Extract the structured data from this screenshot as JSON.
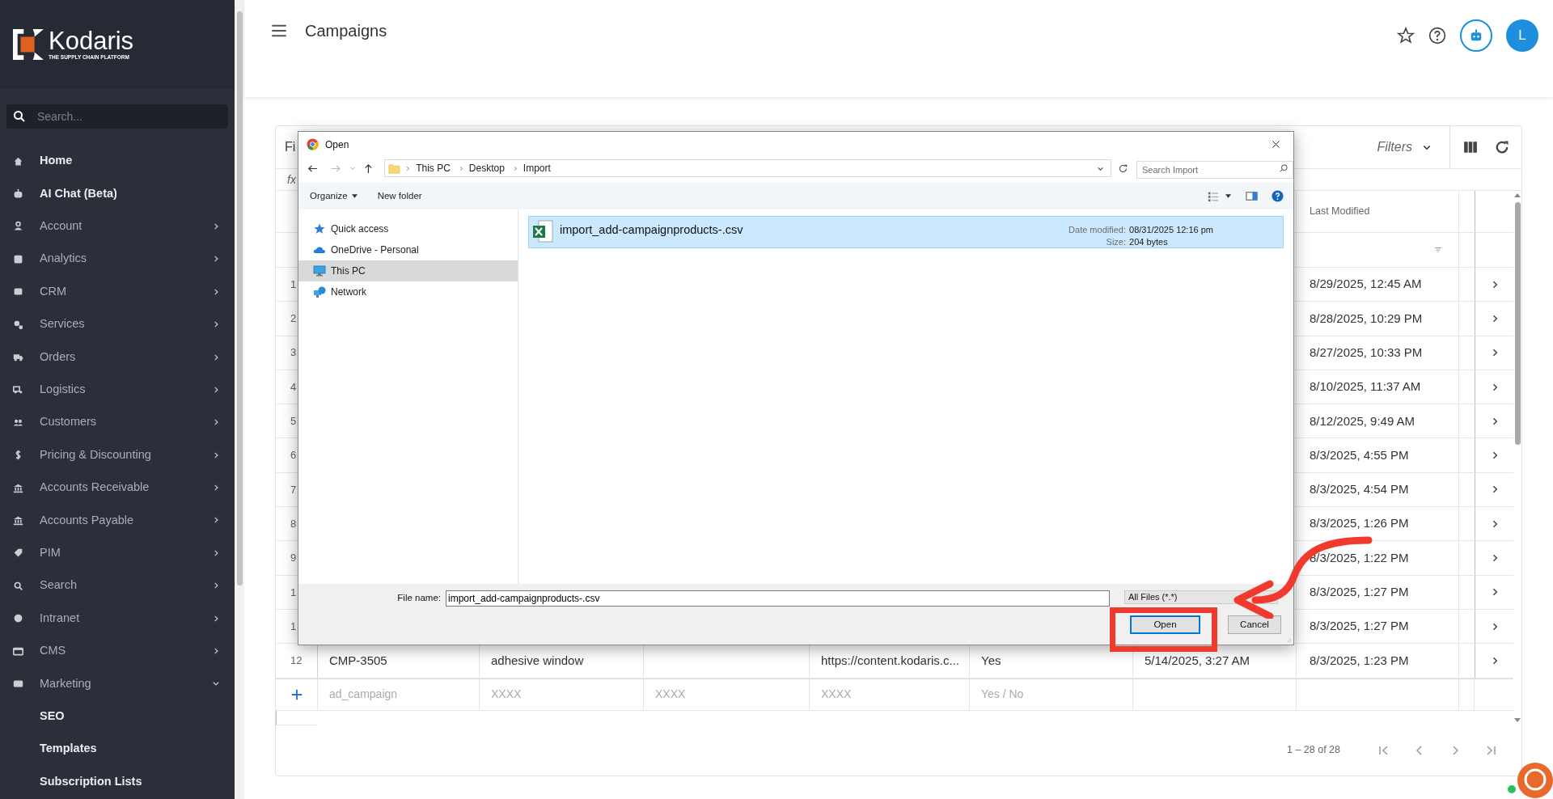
{
  "sidebar": {
    "logo": {
      "name": "Kodaris",
      "tagline": "THE SUPPLY CHAIN PLATFORM"
    },
    "search": {
      "placeholder": "Search..."
    },
    "items": [
      {
        "label": "Home",
        "kind": "link"
      },
      {
        "label": "AI Chat (Beta)",
        "kind": "link"
      },
      {
        "label": "Account",
        "kind": "group",
        "expanded": false
      },
      {
        "label": "Analytics",
        "kind": "group",
        "expanded": false
      },
      {
        "label": "CRM",
        "kind": "group",
        "expanded": false
      },
      {
        "label": "Services",
        "kind": "group",
        "expanded": false
      },
      {
        "label": "Orders",
        "kind": "group",
        "expanded": false
      },
      {
        "label": "Logistics",
        "kind": "group",
        "expanded": false
      },
      {
        "label": "Customers",
        "kind": "group",
        "expanded": false
      },
      {
        "label": "Pricing & Discounting",
        "kind": "group",
        "expanded": false
      },
      {
        "label": "Accounts Receivable",
        "kind": "group",
        "expanded": false
      },
      {
        "label": "Accounts Payable",
        "kind": "group",
        "expanded": false
      },
      {
        "label": "PIM",
        "kind": "group",
        "expanded": false
      },
      {
        "label": "Search",
        "kind": "group",
        "expanded": false
      },
      {
        "label": "Intranet",
        "kind": "group",
        "expanded": false
      },
      {
        "label": "CMS",
        "kind": "group",
        "expanded": false
      },
      {
        "label": "Marketing",
        "kind": "group",
        "expanded": true,
        "children": [
          {
            "label": "SEO",
            "kind": "link"
          },
          {
            "label": "Templates",
            "kind": "link"
          },
          {
            "label": "Subscription Lists",
            "kind": "link"
          }
        ]
      }
    ]
  },
  "header": {
    "title": "Campaigns",
    "avatar": "L"
  },
  "table": {
    "toolbar_title": "Fi",
    "filters": "Filters",
    "formula": "fx",
    "columns": [
      "Last Modified"
    ],
    "rows": [
      {
        "number": "1",
        "last_modified": "8/29/2025, 12:45 AM"
      },
      {
        "number": "2",
        "last_modified": "8/28/2025, 10:29 PM"
      },
      {
        "number": "3",
        "last_modified": "8/27/2025, 10:33 PM"
      },
      {
        "number": "4",
        "last_modified": "8/10/2025, 11:37 AM"
      },
      {
        "number": "5",
        "last_modified": "8/12/2025, 9:49 AM"
      },
      {
        "number": "6",
        "last_modified": "8/3/2025, 4:55 PM"
      },
      {
        "number": "7",
        "last_modified": "8/3/2025, 4:54 PM"
      },
      {
        "number": "8",
        "last_modified": "8/3/2025, 1:26 PM"
      },
      {
        "number": "9",
        "last_modified": "8/3/2025, 1:22 PM"
      },
      {
        "number": "1",
        "last_modified": "8/3/2025, 1:27 PM"
      },
      {
        "number": "1",
        "last_modified": "8/3/2025, 1:27 PM"
      },
      {
        "number": "12",
        "cells": [
          "CMP-3505",
          "adhesive window",
          null,
          "https://content.kodaris.c...",
          "Yes",
          "5/14/2025, 3:27 AM"
        ],
        "last_modified": "8/3/2025, 1:23 PM"
      }
    ],
    "new_row": [
      "ad_campaign",
      "XXXX",
      "XXXX",
      "XXXX",
      "Yes / No"
    ],
    "pagination": "1 – 28 of 28"
  },
  "dialog": {
    "title": "Open",
    "path": [
      "This PC",
      "Desktop",
      "Import"
    ],
    "search": {
      "placeholder": "Search Import"
    },
    "toolbar": [
      "Organize",
      "New folder"
    ],
    "nav": [
      {
        "label": "Quick access",
        "selected": false
      },
      {
        "label": "OneDrive - Personal",
        "selected": false
      },
      {
        "label": "This PC",
        "selected": true
      },
      {
        "label": "Network",
        "selected": false
      }
    ],
    "files": [
      {
        "name": "import_add-campaignproducts-.csv",
        "date_label": "Date modified:",
        "date": "08/31/2025 12:16 pm",
        "size_label": "Size:",
        "size": "204 bytes",
        "selected": true
      }
    ],
    "file_name_label": "File name:",
    "file_name": "import_add-campaignproducts-.csv",
    "file_type": "All Files (*.*)",
    "buttons": [
      "Open",
      "Cancel"
    ]
  }
}
